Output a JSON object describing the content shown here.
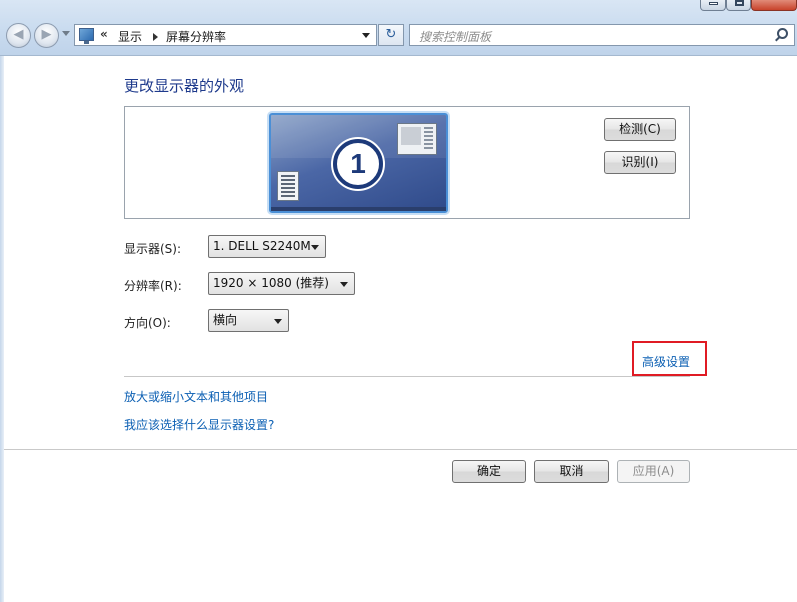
{
  "window_controls": {
    "minimize": "minimize",
    "maximize": "maximize",
    "close": "close"
  },
  "nav": {
    "back_glyph": "◀",
    "forward_glyph": "▶"
  },
  "address_bar": {
    "icon": "control-panel-icon",
    "overflow": "«",
    "crumbs": [
      "显示",
      "屏幕分辨率"
    ]
  },
  "refresh_icon": "↻",
  "search": {
    "placeholder": "搜索控制面板"
  },
  "page": {
    "title": "更改显示器的外观",
    "monitor_number": "1",
    "detect_button": "检测(C)",
    "identify_button": "识别(I)"
  },
  "fields": {
    "display": {
      "label": "显示器(S):",
      "value": "1. DELL S2240M"
    },
    "resolution": {
      "label": "分辨率(R):",
      "value": "1920 × 1080 (推荐)"
    },
    "orientation": {
      "label": "方向(O):",
      "value": "横向"
    }
  },
  "links": {
    "advanced": "高级设置",
    "text_size": "放大或缩小文本和其他项目",
    "which_settings": "我应该选择什么显示器设置?"
  },
  "buttons": {
    "ok": "确定",
    "cancel": "取消",
    "apply": "应用(A)"
  },
  "colors": {
    "link": "#0b5fb3",
    "highlight_box": "#e01b24",
    "title": "#1e3a8c"
  }
}
